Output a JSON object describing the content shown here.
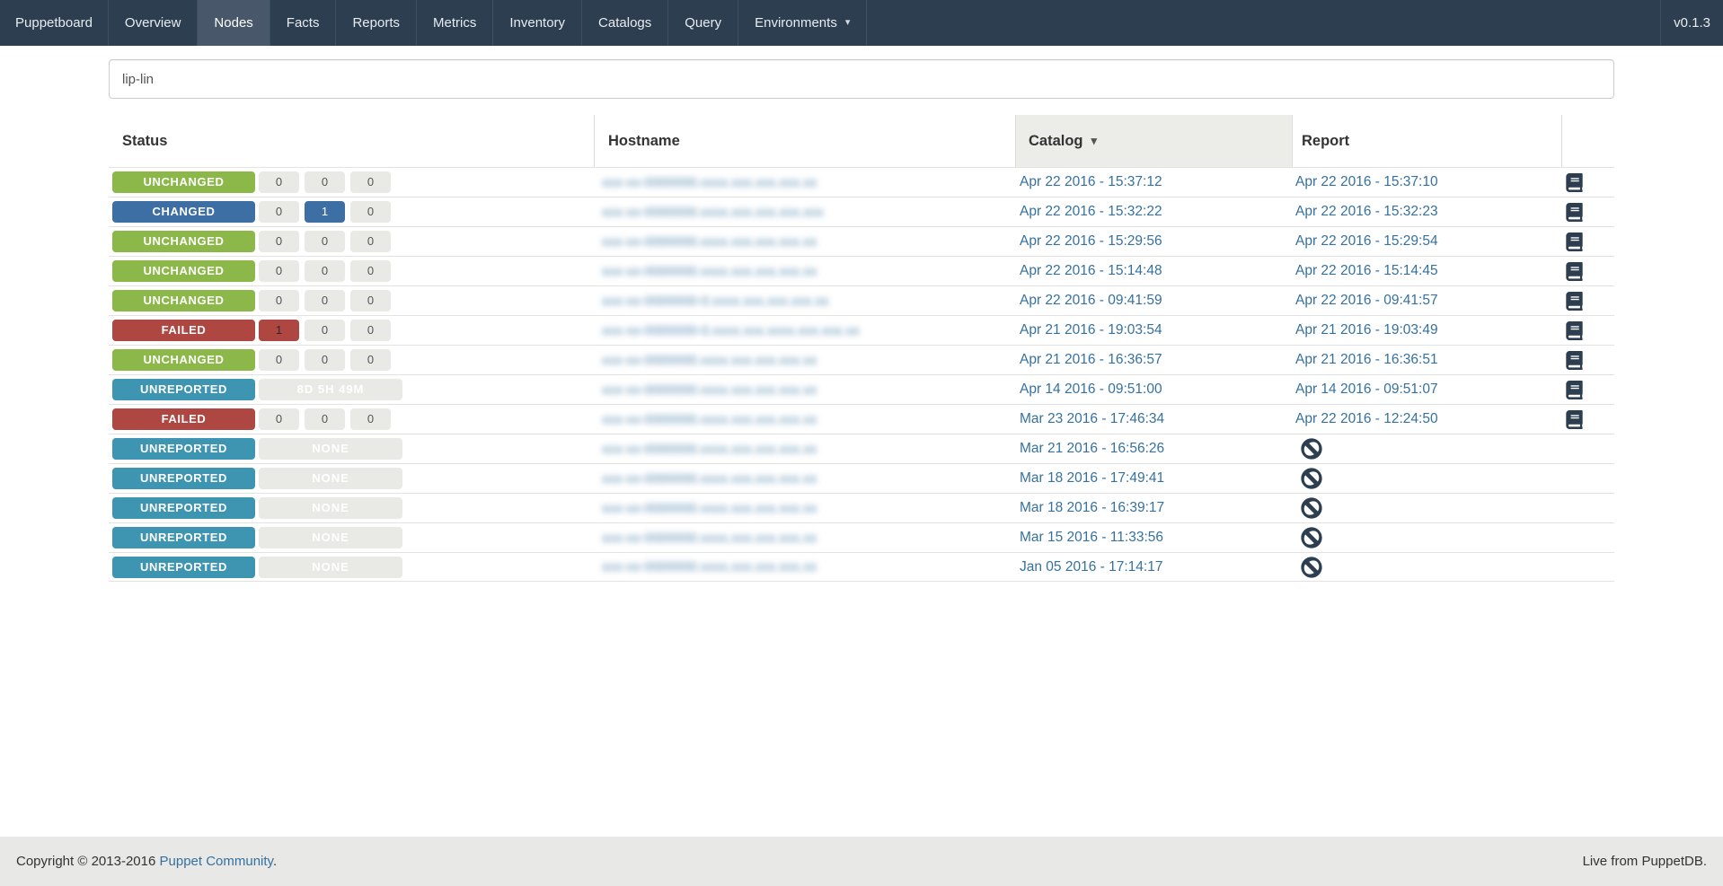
{
  "navbar": {
    "brand": "Puppetboard",
    "items": [
      {
        "id": "overview",
        "label": "Overview",
        "active": false,
        "caret": false
      },
      {
        "id": "nodes",
        "label": "Nodes",
        "active": true,
        "caret": false
      },
      {
        "id": "facts",
        "label": "Facts",
        "active": false,
        "caret": false
      },
      {
        "id": "reports",
        "label": "Reports",
        "active": false,
        "caret": false
      },
      {
        "id": "metrics",
        "label": "Metrics",
        "active": false,
        "caret": false
      },
      {
        "id": "inventory",
        "label": "Inventory",
        "active": false,
        "caret": false
      },
      {
        "id": "catalogs",
        "label": "Catalogs",
        "active": false,
        "caret": false
      },
      {
        "id": "query",
        "label": "Query",
        "active": false,
        "caret": false
      },
      {
        "id": "environments",
        "label": "Environments",
        "active": false,
        "caret": true
      }
    ],
    "version": "v0.1.3"
  },
  "search": {
    "value": "lip-lin",
    "placeholder": ""
  },
  "table": {
    "headers": [
      {
        "id": "status",
        "label": "Status",
        "sorted": false
      },
      {
        "id": "hostname",
        "label": "Hostname",
        "sorted": false
      },
      {
        "id": "catalog",
        "label": "Catalog",
        "sorted": true,
        "sort_caret": "▾"
      },
      {
        "id": "report",
        "label": "Report",
        "sorted": false
      },
      {
        "id": "actions",
        "label": "",
        "sorted": false
      }
    ],
    "rows": [
      {
        "status": "UNCHANGED",
        "status_type": "unchanged",
        "boxes": [
          {
            "text": "0",
            "variant": "default"
          },
          {
            "text": "0",
            "variant": "default"
          },
          {
            "text": "0",
            "variant": "default"
          }
        ],
        "hostname_blurred": "xxx-xx-0000000.xxxx.xxx.xxx.xxx.xx",
        "catalog": "Apr 22 2016 - 15:37:12",
        "report": "Apr 22 2016 - 15:37:10",
        "report_icon": "book"
      },
      {
        "status": "CHANGED",
        "status_type": "changed",
        "boxes": [
          {
            "text": "0",
            "variant": "default"
          },
          {
            "text": "1",
            "variant": "changed"
          },
          {
            "text": "0",
            "variant": "default"
          }
        ],
        "hostname_blurred": "xxx-xx-0000000.xxxx.xxx.xxx.xxx.xxx",
        "catalog": "Apr 22 2016 - 15:32:22",
        "report": "Apr 22 2016 - 15:32:23",
        "report_icon": "book"
      },
      {
        "status": "UNCHANGED",
        "status_type": "unchanged",
        "boxes": [
          {
            "text": "0",
            "variant": "default"
          },
          {
            "text": "0",
            "variant": "default"
          },
          {
            "text": "0",
            "variant": "default"
          }
        ],
        "hostname_blurred": "xxx-xx-0000000.xxxx.xxx.xxx.xxx.xx",
        "catalog": "Apr 22 2016 - 15:29:56",
        "report": "Apr 22 2016 - 15:29:54",
        "report_icon": "book"
      },
      {
        "status": "UNCHANGED",
        "status_type": "unchanged",
        "boxes": [
          {
            "text": "0",
            "variant": "default"
          },
          {
            "text": "0",
            "variant": "default"
          },
          {
            "text": "0",
            "variant": "default"
          }
        ],
        "hostname_blurred": "xxx-xx-0000000.xxxx.xxx.xxx.xxx.xx",
        "catalog": "Apr 22 2016 - 15:14:48",
        "report": "Apr 22 2016 - 15:14:45",
        "report_icon": "book"
      },
      {
        "status": "UNCHANGED",
        "status_type": "unchanged",
        "boxes": [
          {
            "text": "0",
            "variant": "default"
          },
          {
            "text": "0",
            "variant": "default"
          },
          {
            "text": "0",
            "variant": "default"
          }
        ],
        "hostname_blurred": "xxx-xx-0000000-0.xxxx.xxx.xxx.xxx.xx",
        "catalog": "Apr 22 2016 - 09:41:59",
        "report": "Apr 22 2016 - 09:41:57",
        "report_icon": "book"
      },
      {
        "status": "FAILED",
        "status_type": "failed",
        "boxes": [
          {
            "text": "1",
            "variant": "failed"
          },
          {
            "text": "0",
            "variant": "default"
          },
          {
            "text": "0",
            "variant": "default"
          }
        ],
        "hostname_blurred": "xxx-xx-0000000-0.xxxx.xxx.xxxx.xxx.xxx.xx",
        "catalog": "Apr 21 2016 - 19:03:54",
        "report": "Apr 21 2016 - 19:03:49",
        "report_icon": "book"
      },
      {
        "status": "UNCHANGED",
        "status_type": "unchanged",
        "boxes": [
          {
            "text": "0",
            "variant": "default"
          },
          {
            "text": "0",
            "variant": "default"
          },
          {
            "text": "0",
            "variant": "default"
          }
        ],
        "hostname_blurred": "xxx-xx-0000000.xxxx.xxx.xxx.xxx.xx",
        "catalog": "Apr 21 2016 - 16:36:57",
        "report": "Apr 21 2016 - 16:36:51",
        "report_icon": "book"
      },
      {
        "status": "UNREPORTED",
        "status_type": "unreported",
        "boxes": [
          {
            "text": "8D 5H 49M",
            "variant": "wide"
          }
        ],
        "hostname_blurred": "xxx-xx-0000000.xxxx.xxx.xxx.xxx.xx",
        "catalog": "Apr 14 2016 - 09:51:00",
        "report": "Apr 14 2016 - 09:51:07",
        "report_icon": "book"
      },
      {
        "status": "FAILED",
        "status_type": "failed",
        "boxes": [
          {
            "text": "0",
            "variant": "default"
          },
          {
            "text": "0",
            "variant": "default"
          },
          {
            "text": "0",
            "variant": "default"
          }
        ],
        "hostname_blurred": "xxx-xx-0000000.xxxx.xxx.xxx.xxx.xx",
        "catalog": "Mar 23 2016 - 17:46:34",
        "report": "Apr 22 2016 - 12:24:50",
        "report_icon": "book"
      },
      {
        "status": "UNREPORTED",
        "status_type": "unreported",
        "boxes": [
          {
            "text": "NONE",
            "variant": "wide"
          }
        ],
        "hostname_blurred": "xxx-xx-0000000.xxxx.xxx.xxx.xxx.xx",
        "catalog": "Mar 21 2016 - 16:56:26",
        "report": null,
        "report_icon": "ban"
      },
      {
        "status": "UNREPORTED",
        "status_type": "unreported",
        "boxes": [
          {
            "text": "NONE",
            "variant": "wide"
          }
        ],
        "hostname_blurred": "xxx-xx-0000000.xxxx.xxx.xxx.xxx.xx",
        "catalog": "Mar 18 2016 - 17:49:41",
        "report": null,
        "report_icon": "ban"
      },
      {
        "status": "UNREPORTED",
        "status_type": "unreported",
        "boxes": [
          {
            "text": "NONE",
            "variant": "wide"
          }
        ],
        "hostname_blurred": "xxx-xx-0000000.xxxx.xxx.xxx.xxx.xx",
        "catalog": "Mar 18 2016 - 16:39:17",
        "report": null,
        "report_icon": "ban"
      },
      {
        "status": "UNREPORTED",
        "status_type": "unreported",
        "boxes": [
          {
            "text": "NONE",
            "variant": "wide"
          }
        ],
        "hostname_blurred": "xxx-xx-0000000.xxxx.xxx.xxx.xxx.xx",
        "catalog": "Mar 15 2016 - 11:33:56",
        "report": null,
        "report_icon": "ban"
      },
      {
        "status": "UNREPORTED",
        "status_type": "unreported",
        "boxes": [
          {
            "text": "NONE",
            "variant": "wide"
          }
        ],
        "hostname_blurred": "xxx-xx-0000000.xxxx.xxx.xxx.xxx.xx",
        "catalog": "Jan 05 2016 - 17:14:17",
        "report": null,
        "report_icon": "ban"
      }
    ]
  },
  "footer": {
    "copyright_prefix": "Copyright © 2013-2016 ",
    "community_link": "Puppet Community",
    "copyright_suffix": ".",
    "right_text": "Live from PuppetDB."
  },
  "colors": {
    "navbar_bg": "#2c3e50",
    "unchanged": "#8cb849",
    "changed": "#3d6fa5",
    "failed": "#ae4642",
    "unreported": "#3d95b2",
    "link": "#35719f",
    "icon": "#2c3e50",
    "sorted_header_bg": "#ecede9"
  }
}
